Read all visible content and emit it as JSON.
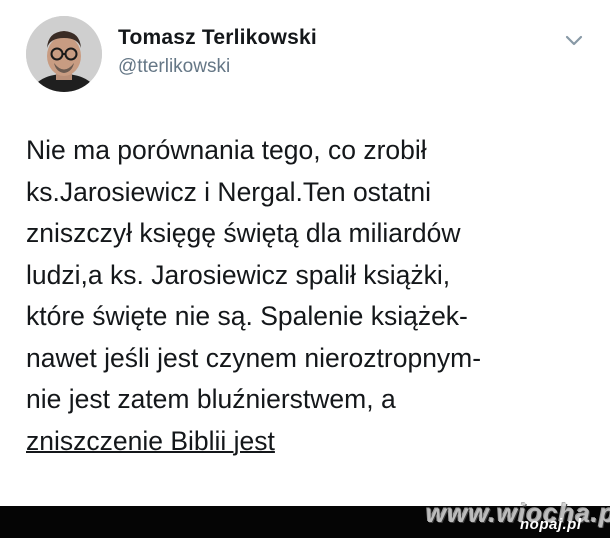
{
  "author": {
    "name": "Tomasz Terlikowski",
    "handle": "@tterlikowski",
    "avatar_icon": "profile-photo"
  },
  "menu_icon": "chevron-down-icon",
  "tweet_lines": [
    "Nie ma porównania tego, co zrobił",
    "ks.Jarosiewicz i Nergal.Ten ostatni",
    "zniszczył księgę świętą dla miliardów",
    "ludzi,a ks. Jarosiewicz spalił książki,",
    "które święte nie są. Spalenie książek-",
    "nawet jeśli jest czynem nieroztropnym-",
    "nie jest zatem bluźnierstwem, a",
    "zniszczenie Biblii jest"
  ],
  "watermark": {
    "site": "www.wiocha.pl",
    "sub": "nopaj.pl"
  },
  "colors": {
    "text": "#14171a",
    "handle": "#657786",
    "bar": "#050505"
  }
}
